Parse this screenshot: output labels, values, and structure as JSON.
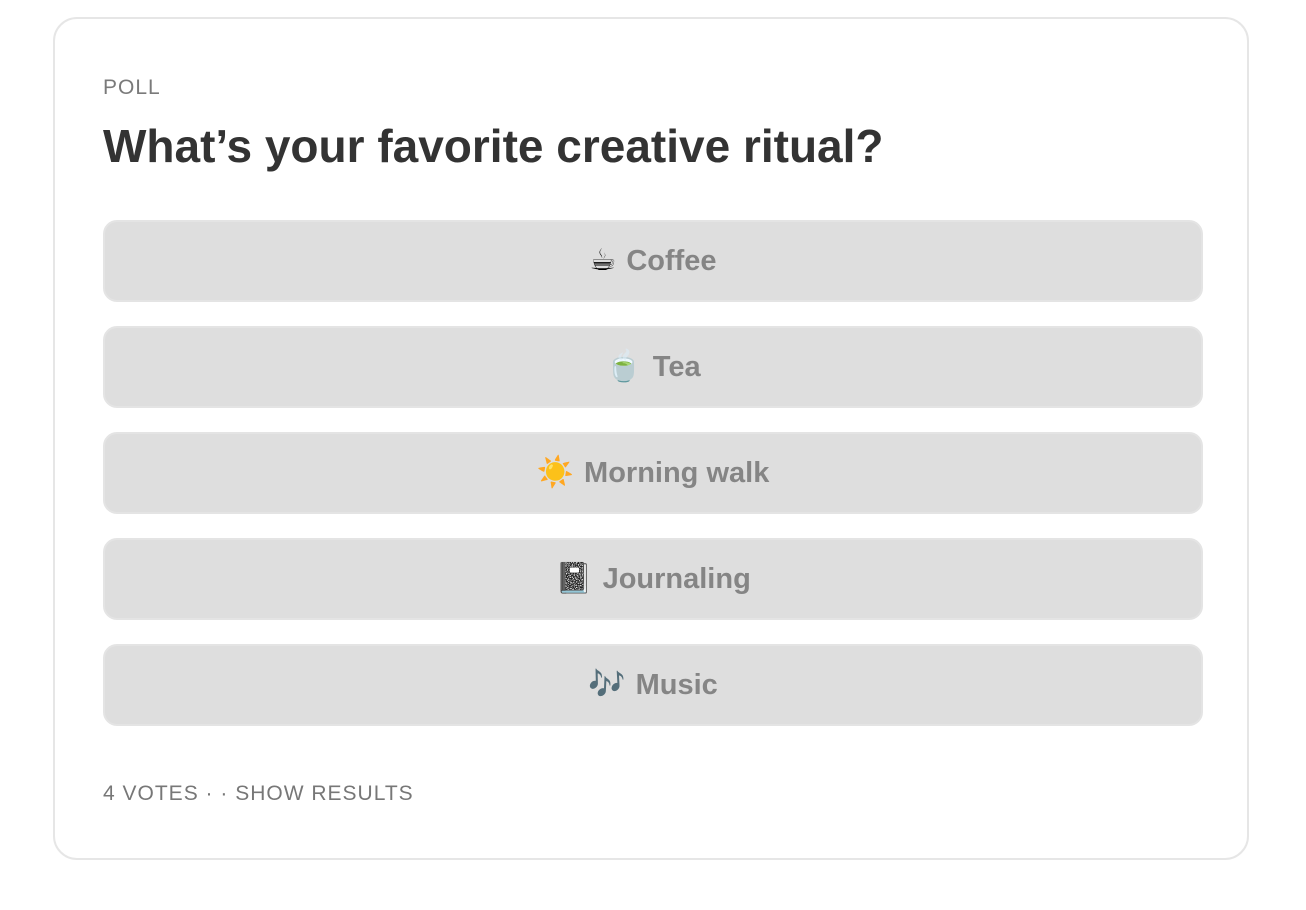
{
  "poll": {
    "kicker": "POLL",
    "question": "What’s your favorite creative ritual?",
    "options": [
      {
        "emoji": "☕",
        "icon": "coffee-cup-icon",
        "label": "Coffee"
      },
      {
        "emoji": "🍵",
        "icon": "tea-cup-icon",
        "label": "Tea"
      },
      {
        "emoji": "☀️",
        "icon": "sun-icon",
        "label": "Morning walk"
      },
      {
        "emoji": "📓",
        "icon": "notebook-icon",
        "label": "Journaling"
      },
      {
        "emoji": "🎶",
        "icon": "music-notes-icon",
        "label": "Music"
      }
    ],
    "footer": {
      "votes": "4 VOTES",
      "separator": " · · ",
      "show_results": "SHOW RESULTS"
    }
  }
}
